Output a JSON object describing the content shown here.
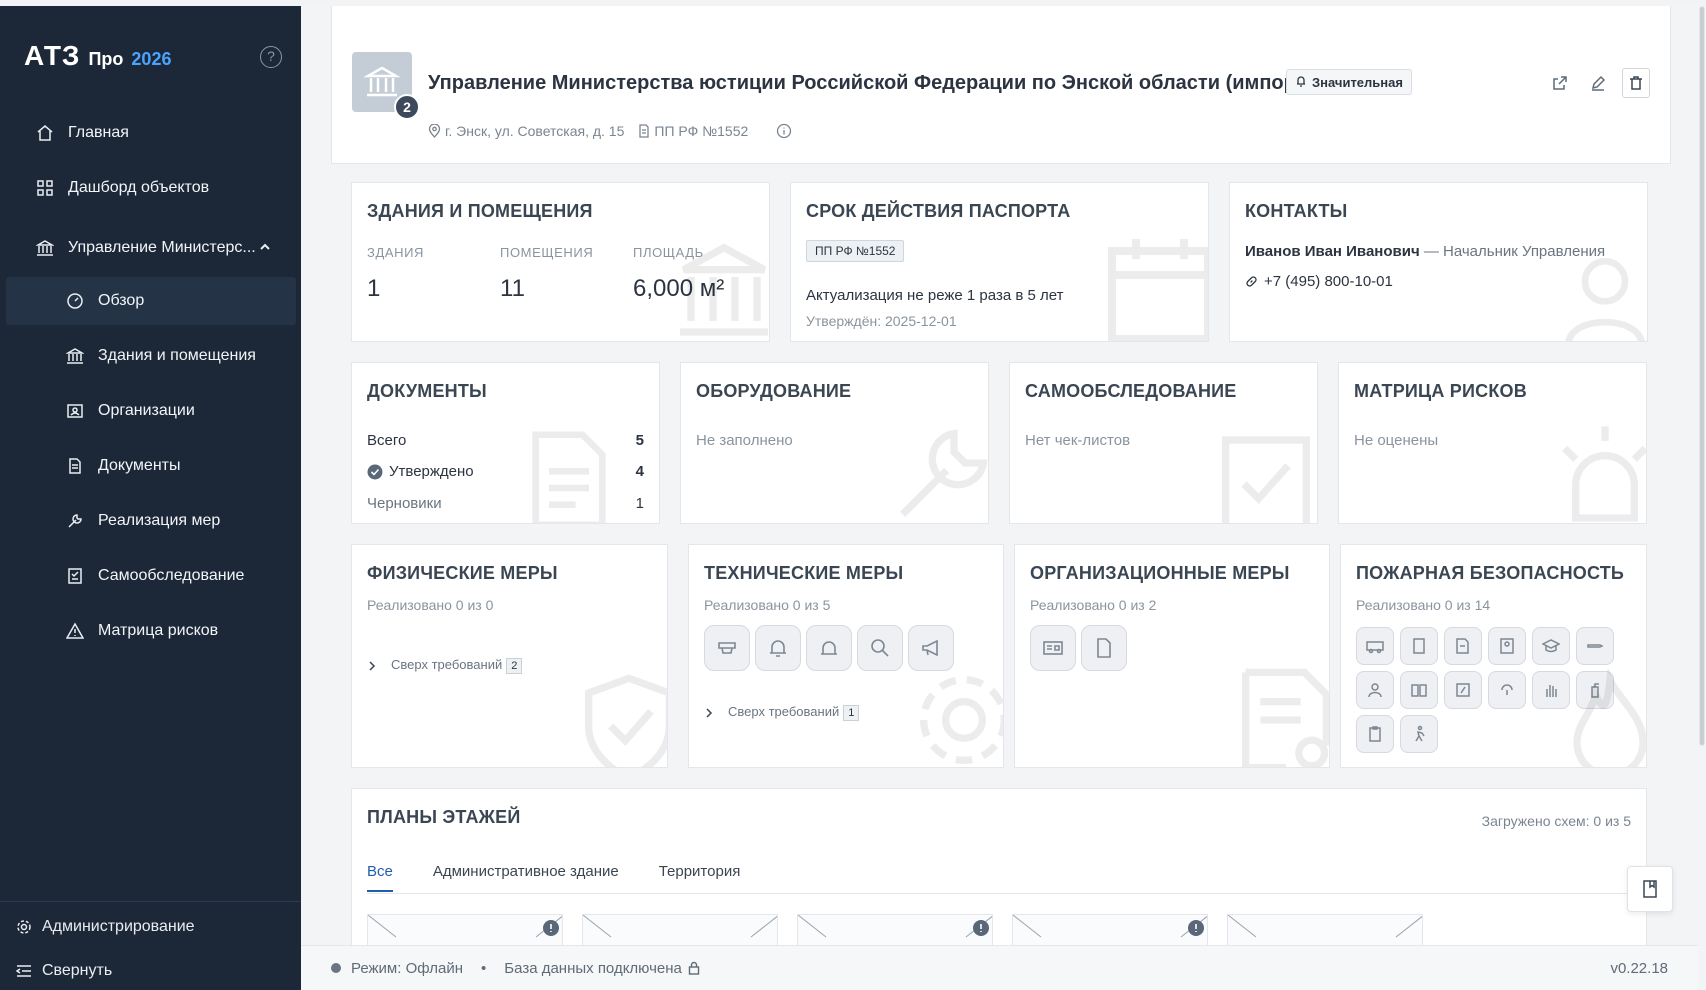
{
  "app": {
    "logo": "АТЗ",
    "edition": "Про",
    "year": "2026"
  },
  "sidebar": {
    "top_items": [
      {
        "label": "Главная",
        "icon": "home-icon"
      },
      {
        "label": "Дашборд объектов",
        "icon": "grid-icon"
      },
      {
        "label": "Управление Министерс...",
        "icon": "bank-icon"
      }
    ],
    "sub_items": [
      {
        "label": "Обзор",
        "icon": "gauge-icon",
        "active": true
      },
      {
        "label": "Здания и помещения",
        "icon": "bank-icon"
      },
      {
        "label": "Организации",
        "icon": "org-icon"
      },
      {
        "label": "Документы",
        "icon": "document-icon"
      },
      {
        "label": "Реализация мер",
        "icon": "wrench-icon"
      },
      {
        "label": "Самообследование",
        "icon": "checklist-icon"
      },
      {
        "label": "Матрица рисков",
        "icon": "warning-icon"
      }
    ],
    "admin_label": "Администрирование",
    "collapse_label": "Свернуть"
  },
  "header": {
    "badge_count": "2",
    "title": "Управление Министерства юстиции Российской Федерации по Энской области (импорт)",
    "significance": "Значительная",
    "address": "г. Энск, ул. Советская, д. 15",
    "regulation": "ПП РФ №1552"
  },
  "buildings": {
    "title": "ЗДАНИЯ И ПОМЕЩЕНИЯ",
    "stats": [
      {
        "label": "ЗДАНИЯ",
        "value": "1"
      },
      {
        "label": "ПОМЕЩЕНИЯ",
        "value": "11"
      },
      {
        "label": "ПЛОЩАДЬ",
        "value": "6,000 м²"
      }
    ]
  },
  "passport": {
    "title": "СРОК ДЕЙСТВИЯ ПАСПОРТА",
    "badge": "ПП РФ №1552",
    "line1": "Актуализация не реже 1 раза в 5 лет",
    "line2": "Утверждён: 2025-12-01"
  },
  "contacts": {
    "title": "КОНТАКТЫ",
    "name": "Иванов Иван Иванович",
    "role": "— Начальник Управления",
    "phone": "+7 (495) 800-10-01"
  },
  "documents": {
    "title": "ДОКУМЕНТЫ",
    "rows": [
      {
        "label": "Всего",
        "value": "5"
      },
      {
        "label": "Утверждено",
        "value": "4"
      },
      {
        "label": "Черновики",
        "value": "1"
      }
    ]
  },
  "equipment": {
    "title": "ОБОРУДОВАНИЕ",
    "text": "Не заполнено"
  },
  "selfcheck": {
    "title": "САМООБСЛЕДОВАНИЕ",
    "text": "Нет чек-листов"
  },
  "risks": {
    "title": "МАТРИЦА РИСКОВ",
    "text": "Не оценены"
  },
  "physical": {
    "title": "ФИЗИЧЕСКИЕ МЕРЫ",
    "progress": "Реализовано 0 из 0",
    "extra_label": "Сверх требований",
    "extra_count": "2"
  },
  "technical": {
    "title": "ТЕХНИЧЕСКИЕ МЕРЫ",
    "progress": "Реализовано 0 из 5",
    "extra_label": "Сверх требований",
    "extra_count": "1"
  },
  "organizational": {
    "title": "ОРГАНИЗАЦИОННЫЕ МЕРЫ",
    "progress": "Реализовано 0 из 2"
  },
  "fire": {
    "title": "ПОЖАРНАЯ БЕЗОПАСНОСТЬ",
    "progress": "Реализовано 0 из 14"
  },
  "floorplans": {
    "title": "ПЛАНЫ ЭТАЖЕЙ",
    "loaded": "Загружено схем: 0 из 5",
    "tabs": [
      "Все",
      "Административное здание",
      "Территория"
    ]
  },
  "status": {
    "mode": "Режим: Офлайн",
    "db": "База данных подключена",
    "version": "v0.22.18"
  },
  "colors": {
    "sidebar_bg": "#1c2838",
    "accent": "#1f5fae",
    "logo_year": "#4aa3ff"
  }
}
